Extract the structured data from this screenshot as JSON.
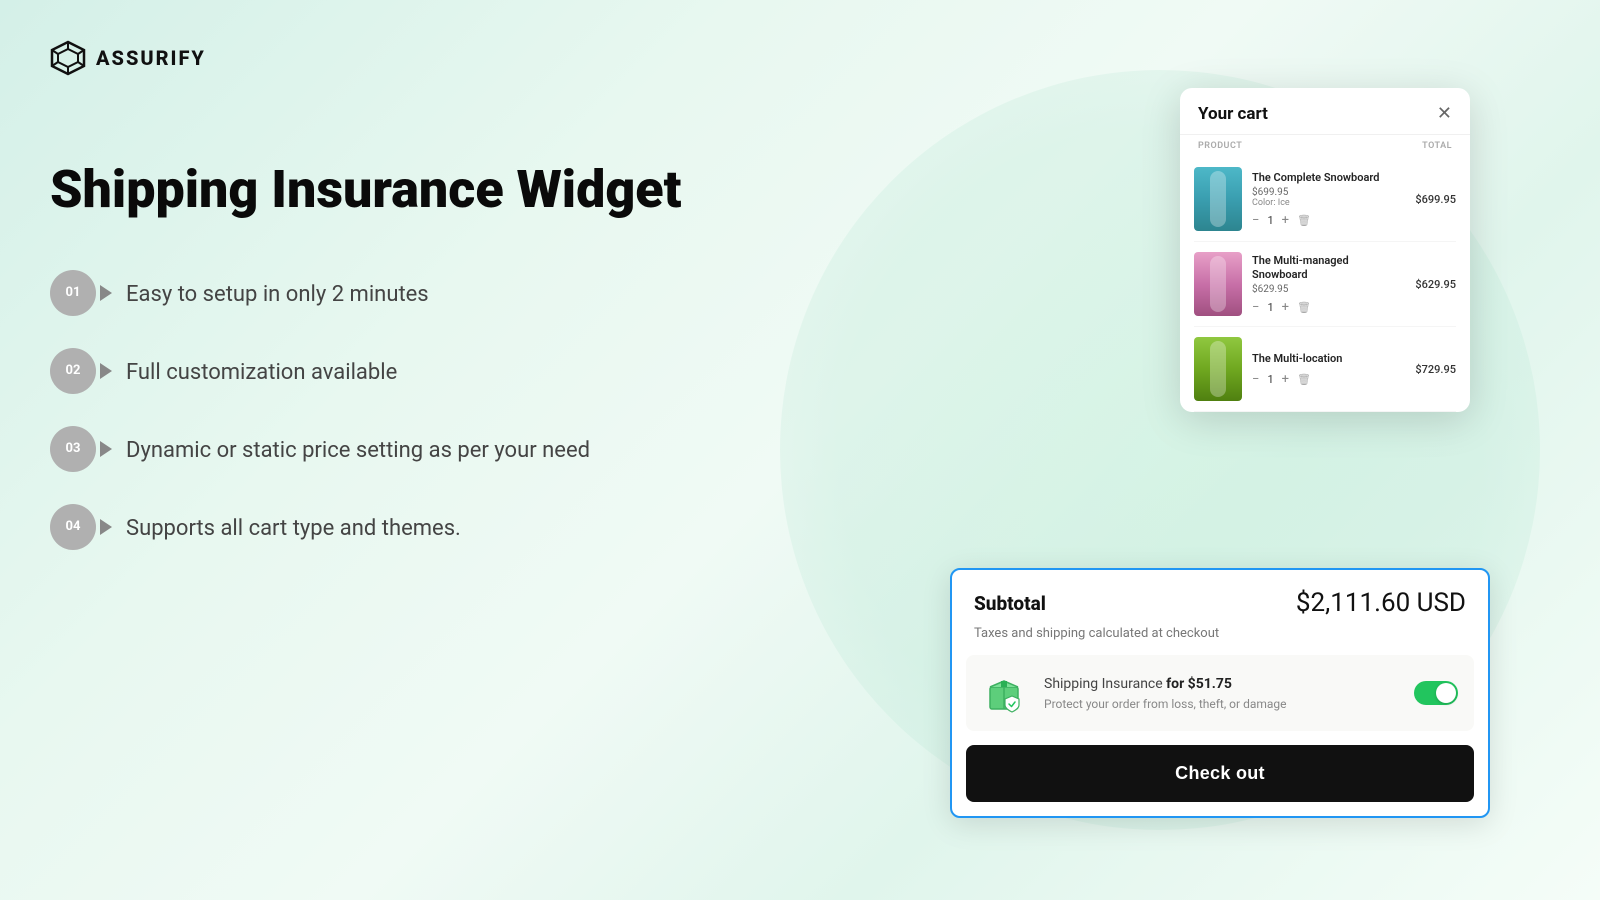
{
  "logo": {
    "text": "ASSURIFY",
    "icon_name": "assurify-logo-icon"
  },
  "left": {
    "title": "Shipping Insurance Widget",
    "features": [
      {
        "id": "01",
        "text": "Easy to setup in only 2 minutes"
      },
      {
        "id": "02",
        "text": "Full customization available"
      },
      {
        "id": "03",
        "text": "Dynamic or static price setting as per your need"
      },
      {
        "id": "04",
        "text": "Supports all cart type and themes."
      }
    ]
  },
  "cart": {
    "title": "Your cart",
    "col_product": "PRODUCT",
    "col_total": "TOTAL",
    "items": [
      {
        "name": "The Complete Snowboard",
        "price": "$699.95",
        "price_sub": "$699.95",
        "color": "Color: Ice",
        "qty": "1",
        "image_type": "snowboard1"
      },
      {
        "name": "The Multi-managed Snowboard",
        "price": "$629.95",
        "price_sub": "$629.95",
        "color": "",
        "qty": "1",
        "image_type": "snowboard2"
      },
      {
        "name": "The Multi-location",
        "price": "$729.95",
        "price_sub": "",
        "color": "",
        "qty": "1",
        "image_type": "snowboard3"
      }
    ]
  },
  "widget": {
    "subtotal_label": "Subtotal",
    "subtotal_amount": "$2,111.60 USD",
    "tax_note": "Taxes and shipping calculated at checkout",
    "insurance_title_prefix": "Shipping Insurance ",
    "insurance_title_price": "for $51.75",
    "insurance_desc": "Protect your order from loss, theft, or damage",
    "toggle_on": true,
    "checkout_label": "Check out"
  }
}
